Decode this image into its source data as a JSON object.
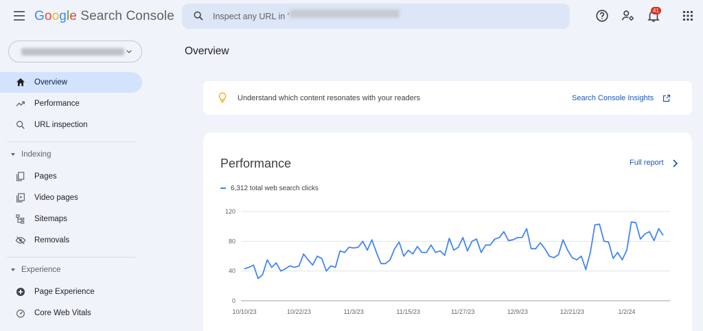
{
  "header": {
    "app_name_google": "Google",
    "app_name_rest": "Search Console",
    "search_placeholder": "Inspect any URL in '                                            '",
    "notification_count": "41"
  },
  "sidebar": {
    "property_label": "https://example.com/",
    "items": [
      {
        "label": "Overview",
        "icon": "home-icon",
        "active": true
      },
      {
        "label": "Performance",
        "icon": "trending-up-icon"
      },
      {
        "label": "URL inspection",
        "icon": "search-icon"
      }
    ],
    "indexing_section": "Indexing",
    "indexing_items": [
      {
        "label": "Pages",
        "icon": "pages-icon"
      },
      {
        "label": "Video pages",
        "icon": "video-pages-icon"
      },
      {
        "label": "Sitemaps",
        "icon": "sitemap-icon"
      },
      {
        "label": "Removals",
        "icon": "removals-icon"
      }
    ],
    "experience_section": "Experience",
    "experience_items": [
      {
        "label": "Page Experience",
        "icon": "page-experience-icon"
      },
      {
        "label": "Core Web Vitals",
        "icon": "core-web-vitals-icon"
      }
    ]
  },
  "main": {
    "page_title": "Overview",
    "insights_text": "Understand which content resonates with your readers",
    "insights_link": "Search Console Insights",
    "performance_title": "Performance",
    "full_report": "Full report",
    "legend": "6,312 total web search clicks"
  },
  "colors": {
    "accent": "#1a57b8",
    "series": "#4285f4",
    "active_nav": "#d3e3fd"
  },
  "chart_data": {
    "type": "line",
    "y_ticks": [
      0,
      40,
      80,
      120
    ],
    "ylim": [
      0,
      120
    ],
    "x_tick_labels": [
      "10/10/23",
      "10/22/23",
      "11/3/23",
      "11/15/23",
      "11/27/23",
      "12/9/23",
      "12/21/23",
      "1/2/24"
    ],
    "x_start": "10/10/23",
    "x_end": "1/11/24",
    "grid": true,
    "series": [
      {
        "name": "6,312 total web search clicks",
        "values": [
          43,
          45,
          48,
          30,
          35,
          55,
          45,
          51,
          40,
          43,
          47,
          45,
          47,
          63,
          55,
          48,
          60,
          57,
          40,
          47,
          45,
          67,
          65,
          72,
          71,
          72,
          80,
          68,
          82,
          65,
          50,
          50,
          55,
          70,
          79,
          60,
          68,
          63,
          73,
          65,
          65,
          75,
          65,
          67,
          61,
          84,
          68,
          72,
          85,
          67,
          80,
          83,
          65,
          75,
          75,
          83,
          85,
          93,
          81,
          82,
          85,
          85,
          97,
          70,
          70,
          78,
          70,
          60,
          58,
          62,
          82,
          68,
          58,
          55,
          60,
          42,
          65,
          102,
          103,
          80,
          79,
          57,
          65,
          55,
          68,
          106,
          105,
          83,
          90,
          93,
          81,
          97,
          88
        ]
      }
    ]
  }
}
